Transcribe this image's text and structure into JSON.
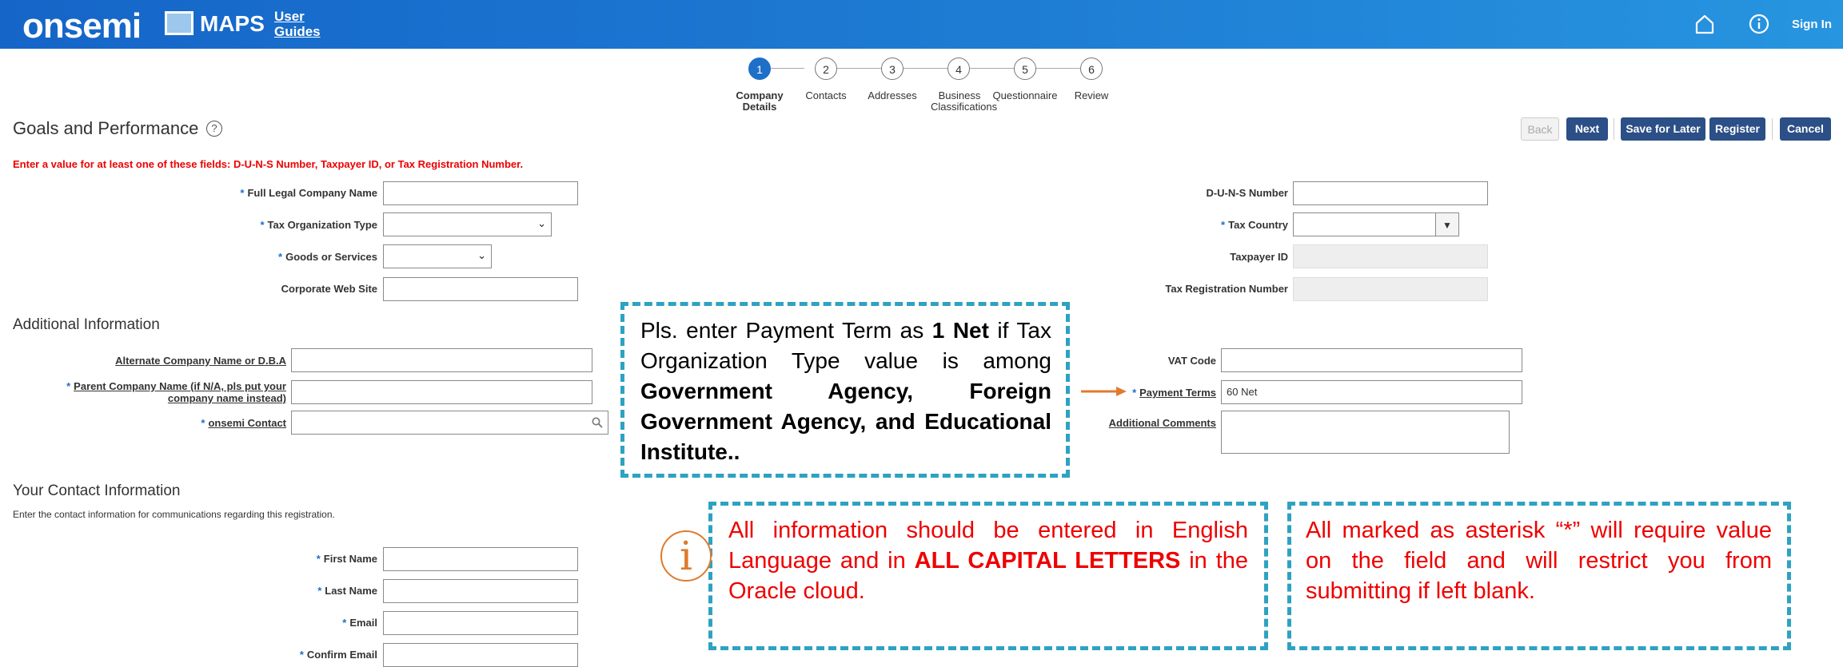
{
  "header": {
    "brand": "onsemi",
    "app_name": "MAPS",
    "user_guides": "User Guides",
    "sign_in": "Sign In",
    "icons": [
      "home-icon",
      "info-icon"
    ]
  },
  "wizard": {
    "steps": [
      {
        "number": "1",
        "label": "Company Details",
        "active": true
      },
      {
        "number": "2",
        "label": "Contacts"
      },
      {
        "number": "3",
        "label": "Addresses"
      },
      {
        "number": "4",
        "label": "Business Classifications"
      },
      {
        "number": "5",
        "label": "Questionnaire"
      },
      {
        "number": "6",
        "label": "Review"
      }
    ]
  },
  "page": {
    "title": "Goals and Performance",
    "warning": "Enter a value for at least one of these fields: D-U-N-S Number, Taxpayer ID, or Tax Registration Number."
  },
  "toolbar": {
    "back": "Back",
    "next": "Next",
    "save_later": "Save for Later",
    "register": "Register",
    "cancel": "Cancel"
  },
  "company": {
    "full_legal_name": {
      "label": "Full Legal Company Name",
      "value": ""
    },
    "tax_org_type": {
      "label": "Tax Organization Type",
      "value": ""
    },
    "goods_services": {
      "label": "Goods or Services",
      "value": ""
    },
    "web_site": {
      "label": "Corporate Web Site",
      "value": ""
    },
    "duns": {
      "label": "D-U-N-S Number",
      "value": ""
    },
    "tax_country": {
      "label": "Tax Country",
      "value": ""
    },
    "taxpayer_id": {
      "label": "Taxpayer ID",
      "value": ""
    },
    "tax_reg_number": {
      "label": "Tax Registration Number",
      "value": ""
    }
  },
  "additional": {
    "title": "Additional Information",
    "alt_name": {
      "label": "Alternate Company Name or D.B.A",
      "value": ""
    },
    "parent_name": {
      "label_line1": "Parent Company Name (if N/A, pls put your",
      "label_line2": "company name instead)",
      "value": ""
    },
    "onsemi_contact": {
      "label": "onsemi Contact",
      "value": ""
    },
    "vat_code": {
      "label": "VAT Code",
      "value": ""
    },
    "payment_terms": {
      "label": "Payment Terms",
      "value": "60 Net"
    },
    "comments": {
      "label": "Additional Comments",
      "value": ""
    }
  },
  "contact": {
    "title": "Your Contact Information",
    "subtitle": "Enter the contact information for communications regarding this registration.",
    "first_name": {
      "label": "First Name",
      "value": ""
    },
    "last_name": {
      "label": "Last Name",
      "value": ""
    },
    "email": {
      "label": "Email",
      "value": ""
    },
    "confirm_email": {
      "label": "Confirm Email",
      "value": ""
    }
  },
  "callouts": {
    "payment": {
      "p1": "Pls. enter Payment Term as ",
      "b1": "1 Net",
      "p2": " if Tax Organization Type value is among ",
      "b2": "Government Agency, Foreign Government Agency, and Educational Institute.."
    },
    "english": {
      "p1": "All information should be entered in English Language and in ",
      "b1": "ALL CAPITAL LETTERS",
      "p2": " in the Oracle cloud."
    },
    "asterisk": {
      "text": "All marked as asterisk “*” will require value on the field and will restrict you from submitting if left blank."
    },
    "info_glyph": "i"
  },
  "colors": {
    "header_blue": "#1f7fd4",
    "button_navy": "#2b4f86",
    "callout_teal": "#2ea2c2",
    "warning_red": "#ee0000",
    "arrow_orange": "#e07a2c"
  }
}
